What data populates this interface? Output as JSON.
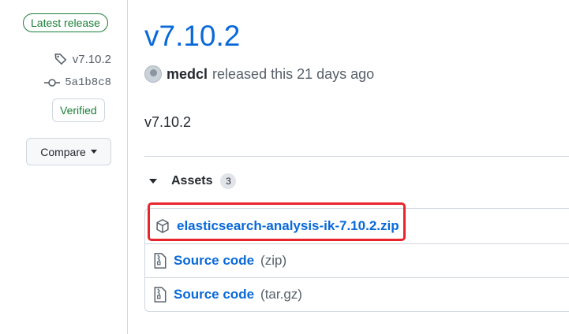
{
  "sidebar": {
    "latest_badge": "Latest release",
    "tag": "v7.10.2",
    "commit": "5a1b8c8",
    "verified": "Verified",
    "compare_label": "Compare"
  },
  "release": {
    "title": "v7.10.2",
    "author": "medcl",
    "released_text": "released this 21 days ago",
    "body": "v7.10.2"
  },
  "assets": {
    "heading": "Assets",
    "count": "3",
    "items": [
      {
        "name": "elasticsearch-analysis-ik-7.10.2.zip",
        "suffix": "",
        "icon": "package-icon"
      },
      {
        "name": "Source code",
        "suffix": "(zip)",
        "icon": "file-zip-icon"
      },
      {
        "name": "Source code",
        "suffix": "(tar.gz)",
        "icon": "file-zip-icon"
      }
    ]
  },
  "colors": {
    "link": "#0969da",
    "success": "#1a7f37",
    "highlight": "#e8242d"
  }
}
